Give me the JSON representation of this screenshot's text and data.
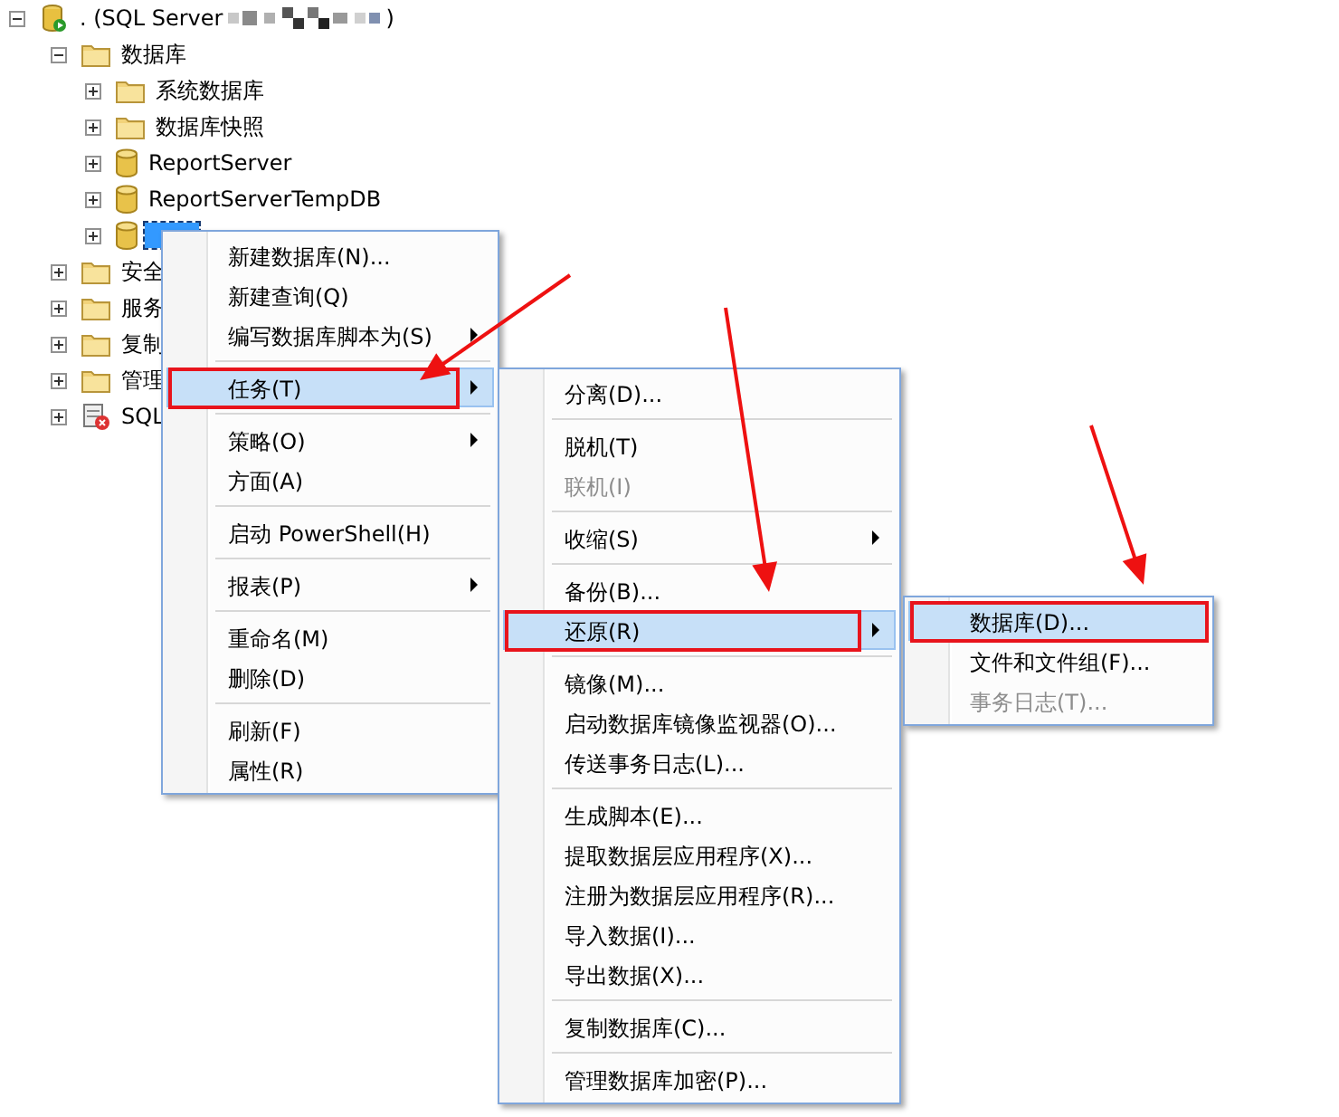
{
  "tree": {
    "label": ". (SQL Server",
    "label_end": ")",
    "kind": "server",
    "expanded": true,
    "children": [
      {
        "label": "数据库",
        "kind": "folder",
        "expanded": true,
        "selected": false,
        "children": [
          {
            "label": "系统数据库",
            "kind": "folder",
            "expanded": false,
            "selected": false
          },
          {
            "label": "数据库快照",
            "kind": "folder",
            "expanded": false,
            "selected": false
          },
          {
            "label": "ReportServer",
            "kind": "database",
            "expanded": false,
            "selected": false
          },
          {
            "label": "ReportServerTempDB",
            "kind": "database",
            "expanded": false,
            "selected": false
          },
          {
            "kind": "database",
            "expanded": false,
            "selected": true
          }
        ]
      },
      {
        "label": "安全",
        "kind": "folder",
        "expanded": false,
        "selected": false
      },
      {
        "label": "服务",
        "kind": "folder",
        "expanded": false,
        "selected": false
      },
      {
        "label": "复制",
        "kind": "folder",
        "expanded": false,
        "selected": false
      },
      {
        "label": "管理",
        "kind": "folder",
        "expanded": false,
        "selected": false
      },
      {
        "label": "SQL",
        "kind": "agent",
        "expanded": false,
        "selected": false
      }
    ]
  },
  "menus": [
    {
      "items": [
        {
          "kind": "item",
          "label": "新建数据库(N)...",
          "selected": false,
          "disabled": false,
          "submenu": false
        },
        {
          "kind": "item",
          "label": "新建查询(Q)",
          "selected": false,
          "disabled": false,
          "submenu": false
        },
        {
          "kind": "item",
          "label": "编写数据库脚本为(S)",
          "selected": false,
          "disabled": false,
          "submenu": true
        },
        {
          "kind": "separator"
        },
        {
          "kind": "item",
          "label": "任务(T)",
          "selected": true,
          "disabled": false,
          "submenu": true
        },
        {
          "kind": "separator"
        },
        {
          "kind": "item",
          "label": "策略(O)",
          "selected": false,
          "disabled": false,
          "submenu": true
        },
        {
          "kind": "item",
          "label": "方面(A)",
          "selected": false,
          "disabled": false,
          "submenu": false
        },
        {
          "kind": "separator"
        },
        {
          "kind": "item",
          "label": "启动 PowerShell(H)",
          "selected": false,
          "disabled": false,
          "submenu": false
        },
        {
          "kind": "separator"
        },
        {
          "kind": "item",
          "label": "报表(P)",
          "selected": false,
          "disabled": false,
          "submenu": true
        },
        {
          "kind": "separator"
        },
        {
          "kind": "item",
          "label": "重命名(M)",
          "selected": false,
          "disabled": false,
          "submenu": false
        },
        {
          "kind": "item",
          "label": "删除(D)",
          "selected": false,
          "disabled": false,
          "submenu": false
        },
        {
          "kind": "separator"
        },
        {
          "kind": "item",
          "label": "刷新(F)",
          "selected": false,
          "disabled": false,
          "submenu": false
        },
        {
          "kind": "item",
          "label": "属性(R)",
          "selected": false,
          "disabled": false,
          "submenu": false
        }
      ]
    },
    {
      "items": [
        {
          "kind": "item",
          "label": "分离(D)...",
          "selected": false,
          "disabled": false,
          "submenu": false
        },
        {
          "kind": "separator"
        },
        {
          "kind": "item",
          "label": "脱机(T)",
          "selected": false,
          "disabled": false,
          "submenu": false
        },
        {
          "kind": "item",
          "label": "联机(I)",
          "selected": false,
          "disabled": true,
          "submenu": false
        },
        {
          "kind": "separator"
        },
        {
          "kind": "item",
          "label": "收缩(S)",
          "selected": false,
          "disabled": false,
          "submenu": true
        },
        {
          "kind": "separator"
        },
        {
          "kind": "item",
          "label": "备份(B)...",
          "selected": false,
          "disabled": false,
          "submenu": false
        },
        {
          "kind": "item",
          "label": "还原(R)",
          "selected": true,
          "disabled": false,
          "submenu": true
        },
        {
          "kind": "separator"
        },
        {
          "kind": "item",
          "label": "镜像(M)...",
          "selected": false,
          "disabled": false,
          "submenu": false
        },
        {
          "kind": "item",
          "label": "启动数据库镜像监视器(O)...",
          "selected": false,
          "disabled": false,
          "submenu": false
        },
        {
          "kind": "item",
          "label": "传送事务日志(L)...",
          "selected": false,
          "disabled": false,
          "submenu": false
        },
        {
          "kind": "separator"
        },
        {
          "kind": "item",
          "label": "生成脚本(E)...",
          "selected": false,
          "disabled": false,
          "submenu": false
        },
        {
          "kind": "item",
          "label": "提取数据层应用程序(X)...",
          "selected": false,
          "disabled": false,
          "submenu": false
        },
        {
          "kind": "item",
          "label": "注册为数据层应用程序(R)...",
          "selected": false,
          "disabled": false,
          "submenu": false
        },
        {
          "kind": "item",
          "label": "导入数据(I)...",
          "selected": false,
          "disabled": false,
          "submenu": false
        },
        {
          "kind": "item",
          "label": "导出数据(X)...",
          "selected": false,
          "disabled": false,
          "submenu": false
        },
        {
          "kind": "separator"
        },
        {
          "kind": "item",
          "label": "复制数据库(C)...",
          "selected": false,
          "disabled": false,
          "submenu": false
        },
        {
          "kind": "separator"
        },
        {
          "kind": "item",
          "label": "管理数据库加密(P)...",
          "selected": false,
          "disabled": false,
          "submenu": false
        }
      ]
    },
    {
      "items": [
        {
          "kind": "item",
          "label": "数据库(D)...",
          "selected": true,
          "disabled": false,
          "submenu": false
        },
        {
          "kind": "item",
          "label": "文件和文件组(F)...",
          "selected": false,
          "disabled": false,
          "submenu": false
        },
        {
          "kind": "item",
          "label": "事务日志(T)...",
          "selected": false,
          "disabled": true,
          "submenu": false
        }
      ]
    }
  ]
}
